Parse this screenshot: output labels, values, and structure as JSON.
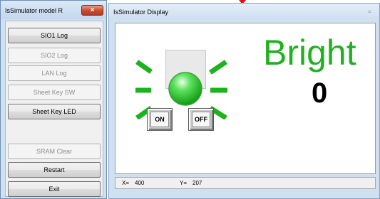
{
  "left_window": {
    "title": "IsSimulator model R",
    "close_label": "×",
    "buttons": [
      {
        "label": "SIO1 Log",
        "enabled": true
      },
      {
        "label": "SIO2 Log",
        "enabled": false
      },
      {
        "label": "LAN Log",
        "enabled": false
      },
      {
        "label": "Sheet Key SW",
        "enabled": false
      },
      {
        "label": "Sheet Key LED",
        "enabled": true
      },
      {
        "label": "SRAM Clear",
        "enabled": false
      },
      {
        "label": "Restart",
        "enabled": true
      },
      {
        "label": "Exit",
        "enabled": true
      }
    ]
  },
  "right_window": {
    "title": "IsSimulator Display",
    "close_label": "⌗",
    "led": {
      "state": "on",
      "color": "#22c422",
      "rays_color": "#1fb21f"
    },
    "on_button": "ON",
    "off_button": "OFF",
    "bright_label": "Bright",
    "bright_value": "0",
    "status": {
      "x_label": "X=",
      "x_value": "400",
      "y_label": "Y=",
      "y_value": "207"
    }
  },
  "colors": {
    "accent_green": "#1fb21f",
    "close_red": "#c6492c",
    "window_frame": "#cfe0f1"
  }
}
